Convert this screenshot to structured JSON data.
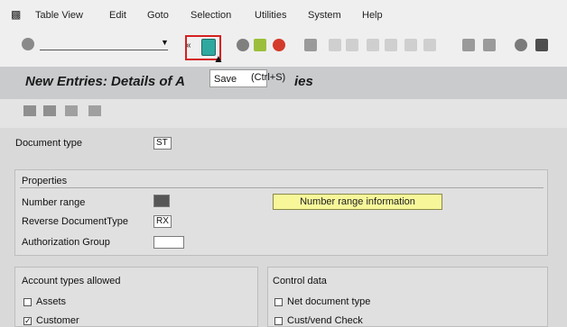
{
  "menu": [
    "Table View",
    "Edit",
    "Goto",
    "Selection",
    "Utilities",
    "System",
    "Help"
  ],
  "toolbar": {
    "command_field_value": "",
    "save_tooltip": "Save",
    "save_shortcut": "(Ctrl+S)"
  },
  "title": {
    "prefix": "New Entries: Details of A",
    "suffix": "ies"
  },
  "document_type": {
    "label": "Document type",
    "value": "ST"
  },
  "properties": {
    "title": "Properties",
    "number_range_label": "Number range",
    "number_range_value": "",
    "reverse_doc_type_label": "Reverse DocumentType",
    "reverse_doc_type_value": "RX",
    "auth_group_label": "Authorization Group",
    "auth_group_value": "",
    "number_range_button": "Number range information"
  },
  "account_types": {
    "title": "Account types allowed",
    "items": [
      {
        "label": "Assets",
        "checked": false
      },
      {
        "label": "Customer",
        "checked": true
      }
    ]
  },
  "control_data": {
    "title": "Control data",
    "items": [
      {
        "label": "Net document type",
        "checked": false
      },
      {
        "label": "Cust/vend Check",
        "checked": false
      }
    ]
  }
}
